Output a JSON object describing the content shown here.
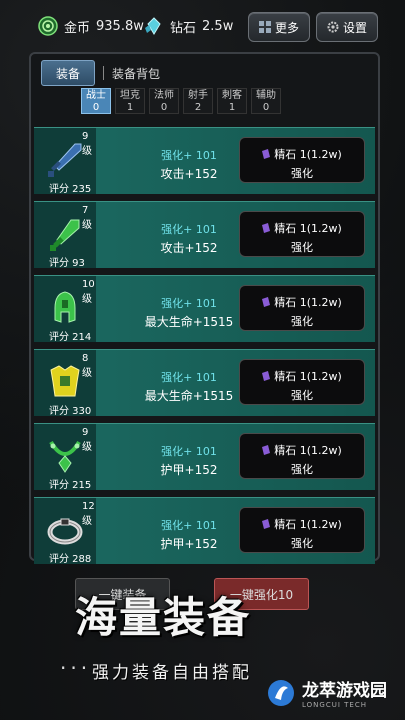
{
  "resources": {
    "coin_label": "金币",
    "coin_value": "935.8w",
    "diamond_label": "钻石",
    "diamond_value": "2.5w"
  },
  "top_buttons": {
    "more": "更多",
    "settings": "设置"
  },
  "tabs": {
    "active": "装备",
    "other": "装备背包"
  },
  "classes": [
    {
      "name": "战士",
      "count": "0",
      "selected": true
    },
    {
      "name": "坦克",
      "count": "1",
      "selected": false
    },
    {
      "name": "法师",
      "count": "0",
      "selected": false
    },
    {
      "name": "射手",
      "count": "2",
      "selected": false
    },
    {
      "name": "刺客",
      "count": "1",
      "selected": false
    },
    {
      "name": "辅助",
      "count": "0",
      "selected": false
    }
  ],
  "cards": [
    {
      "level": "9级",
      "score": "评分 235",
      "enhance": "强化+ 101",
      "stat": "攻击+152",
      "cost": "精石 1(1.2w)",
      "button": "强化",
      "icon": "sword-icon",
      "color": "#3a6fb0"
    },
    {
      "level": "7级",
      "score": "评分 93",
      "enhance": "强化+ 101",
      "stat": "攻击+152",
      "cost": "精石 1(1.2w)",
      "button": "强化",
      "icon": "dagger-icon",
      "color": "#3cc24a"
    },
    {
      "level": "10级",
      "score": "评分 214",
      "enhance": "强化+ 101",
      "stat": "最大生命+1515",
      "cost": "精石 1(1.2w)",
      "button": "强化",
      "icon": "helmet-icon",
      "color": "#3cc24a"
    },
    {
      "level": "8级",
      "score": "评分 330",
      "enhance": "强化+ 101",
      "stat": "最大生命+1515",
      "cost": "精石 1(1.2w)",
      "button": "强化",
      "icon": "armor-icon",
      "color": "#e0d21e"
    },
    {
      "level": "9级",
      "score": "评分 215",
      "enhance": "强化+ 101",
      "stat": "护甲+152",
      "cost": "精石 1(1.2w)",
      "button": "强化",
      "icon": "necklace-icon",
      "color": "#3cc24a"
    },
    {
      "level": "12级",
      "score": "评分 288",
      "enhance": "强化+ 101",
      "stat": "护甲+152",
      "cost": "精石 1(1.2w)",
      "button": "强化",
      "icon": "ring-icon",
      "color": "#dddddd"
    }
  ],
  "bottom_buttons": {
    "equip_all": "一键装备",
    "enhance_all": "一键强化10"
  },
  "banner": {
    "title": "海量装备",
    "subtitle": "强力装备自由搭配"
  },
  "watermark": {
    "brand": "龙萃游戏园",
    "sub": "LONGCUI TECH"
  },
  "colors": {
    "card": "#1c6a62",
    "accent": "#4a86b7",
    "enhance_text": "#6fe0e8"
  }
}
